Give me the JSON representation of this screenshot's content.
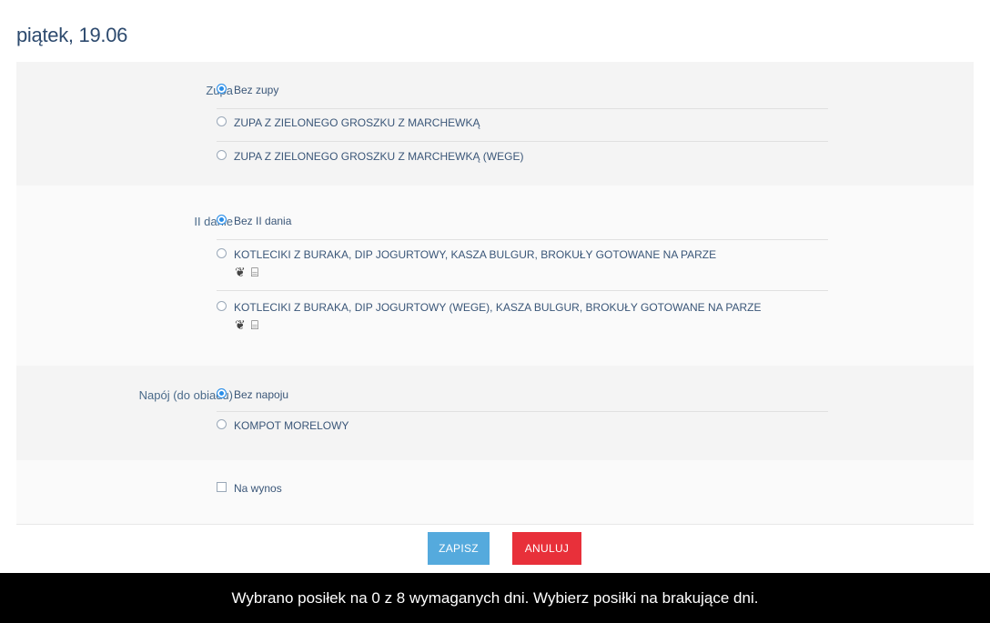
{
  "header": {
    "day_title": "piątek, 19.06"
  },
  "soup": {
    "label": "Zupa",
    "options": [
      {
        "text": "Bez zupy",
        "selected": true
      },
      {
        "text": "ZUPA Z ZIELONEGO GROSZKU Z MARCHEWKĄ",
        "selected": false
      },
      {
        "text": "ZUPA Z ZIELONEGO GROSZKU Z MARCHEWKĄ (WEGE)",
        "selected": false
      }
    ]
  },
  "main_course": {
    "label": "II danie",
    "options": [
      {
        "text": "Bez II dania",
        "selected": true
      },
      {
        "text": "KOTLECIKI Z BURAKA, DIP JOGURTOWY, KASZA BULGUR, BROKUŁY GOTOWANE NA PARZE",
        "selected": false,
        "allergen_icons": [
          "gluten-icon",
          "milk-icon"
        ]
      },
      {
        "text": "KOTLECIKI Z BURAKA, DIP JOGURTOWY (WEGE), KASZA BULGUR, BROKUŁY GOTOWANE NA PARZE",
        "selected": false,
        "allergen_icons": [
          "gluten-icon",
          "milk-icon"
        ]
      }
    ]
  },
  "drink": {
    "label": "Napój (do obiadu)",
    "options": [
      {
        "text": "Bez napoju",
        "selected": true
      },
      {
        "text": "KOMPOT MORELOWY",
        "selected": false
      }
    ]
  },
  "takeaway": {
    "label": "Na wynos",
    "checked": false
  },
  "buttons": {
    "save": "ZAPISZ",
    "cancel": "ANULUJ"
  },
  "footer": {
    "message": "Wybrano posiłek na 0 z 8 wymaganych dni. Wybierz posiłki na brakujące dni."
  },
  "colors": {
    "save": "#55aadd",
    "cancel": "#e8303a",
    "radio_selected": "#2a8ee8",
    "title": "#2d4a6e"
  }
}
